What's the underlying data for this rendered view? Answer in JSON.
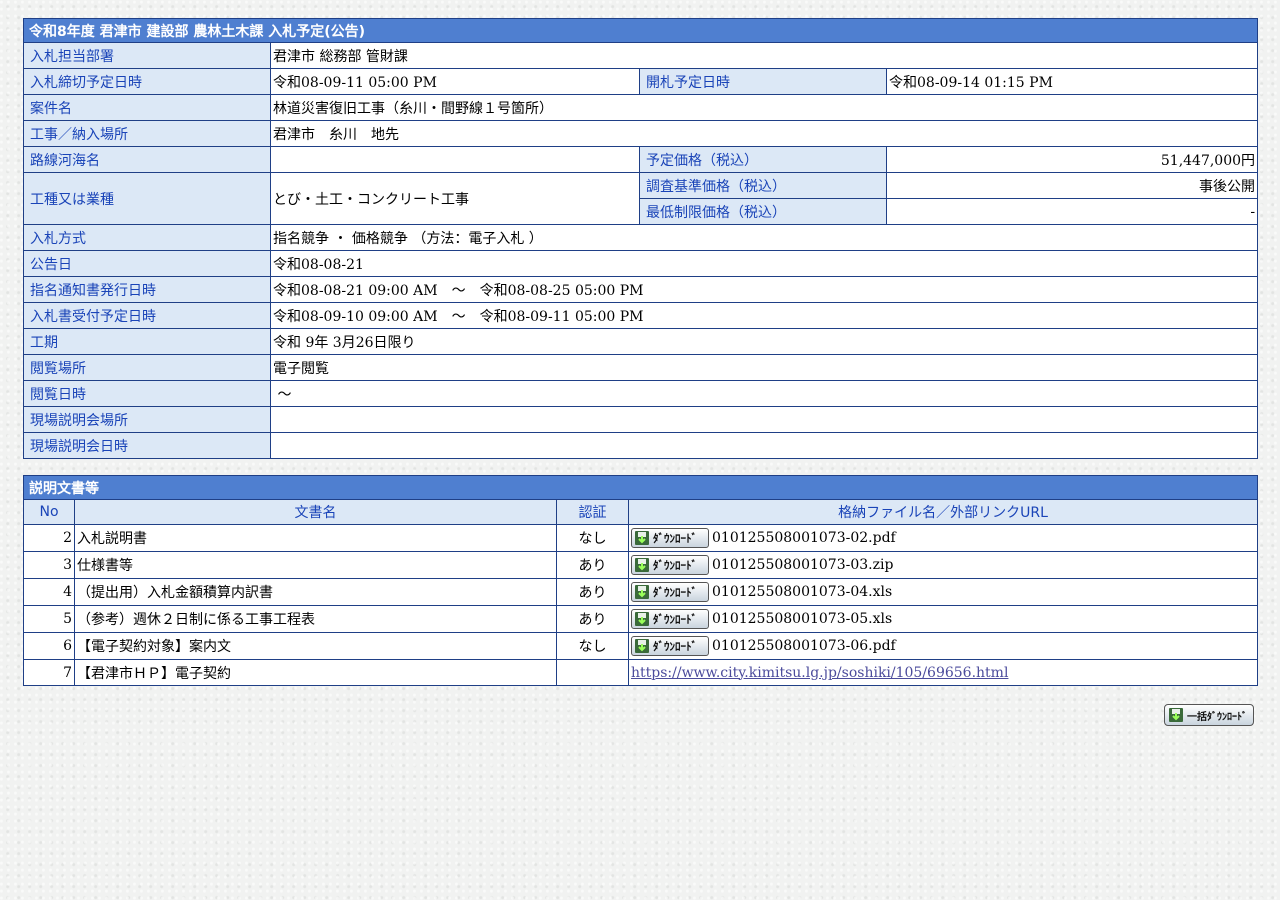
{
  "notice": {
    "title": "令和8年度 君津市 建設部 農林土木課 入札予定(公告)",
    "rows": {
      "dept_label": "入札担当部署",
      "dept_value": "君津市 総務部 管財課",
      "deadline_label": "入札締切予定日時",
      "deadline_value": "令和08-09-11 05:00 PM",
      "opening_label": "開札予定日時",
      "opening_value": "令和08-09-14 01:15 PM",
      "case_label": "案件名",
      "case_value": "林道災害復旧工事（糸川・間野線１号箇所）",
      "place_label": "工事／納入場所",
      "place_value": "君津市　糸川　地先",
      "route_label": "路線河海名",
      "route_value": "",
      "planned_price_label": "予定価格（税込）",
      "planned_price_value": "51,447,000円",
      "type_label": "工種又は業種",
      "type_value": "とび・土工・コンクリート工事",
      "survey_price_label": "調査基準価格（税込）",
      "survey_price_value": "事後公開",
      "min_price_label": "最低制限価格（税込）",
      "min_price_value": "-",
      "method_label": "入札方式",
      "method_value": "指名競争 ・ 価格競争 （方法：電子入札 ）",
      "announce_label": "公告日",
      "announce_value": "令和08-08-21",
      "nomination_label": "指名通知書発行日時",
      "nomination_value": "令和08-08-21 09:00 AM　～　令和08-08-25 05:00 PM",
      "receipt_label": "入札書受付予定日時",
      "receipt_value": "令和08-09-10 09:00 AM　～　令和08-09-11 05:00 PM",
      "period_label": "工期",
      "period_value": "令和 9年 3月26日限り",
      "view_place_label": "閲覧場所",
      "view_place_value": "電子閲覧",
      "view_date_label": "閲覧日時",
      "view_date_value": " ～",
      "site_place_label": "現場説明会場所",
      "site_place_value": "",
      "site_date_label": "現場説明会日時",
      "site_date_value": ""
    }
  },
  "docs": {
    "title": "説明文書等",
    "headers": {
      "no": "No",
      "name": "文書名",
      "auth": "認証",
      "file": "格納ファイル名／外部リンクURL"
    },
    "download_label": "ﾀﾞｳﾝﾛｰﾄﾞ",
    "items": [
      {
        "no": "2",
        "name": "入札説明書",
        "auth": "なし",
        "file": "010125508001073-02.pdf"
      },
      {
        "no": "3",
        "name": "仕様書等",
        "auth": "あり",
        "file": "010125508001073-03.zip"
      },
      {
        "no": "4",
        "name": "（提出用）入札金額積算内訳書",
        "auth": "あり",
        "file": "010125508001073-04.xls"
      },
      {
        "no": "5",
        "name": "（参考）週休２日制に係る工事工程表",
        "auth": "あり",
        "file": "010125508001073-05.xls"
      },
      {
        "no": "6",
        "name": "【電子契約対象】案内文",
        "auth": "なし",
        "file": "010125508001073-06.pdf"
      },
      {
        "no": "7",
        "name": "【君津市ＨＰ】電子契約",
        "auth": "",
        "url": "https://www.city.kimitsu.lg.jp/soshiki/105/69656.html"
      }
    ],
    "bulk_label": "一括ﾀﾞｳﾝﾛｰﾄﾞ"
  },
  "colors": {
    "header_bg": "#4f7fd0",
    "label_bg": "#dce8f6",
    "label_text": "#1a44b8",
    "border": "#1f3f86"
  }
}
